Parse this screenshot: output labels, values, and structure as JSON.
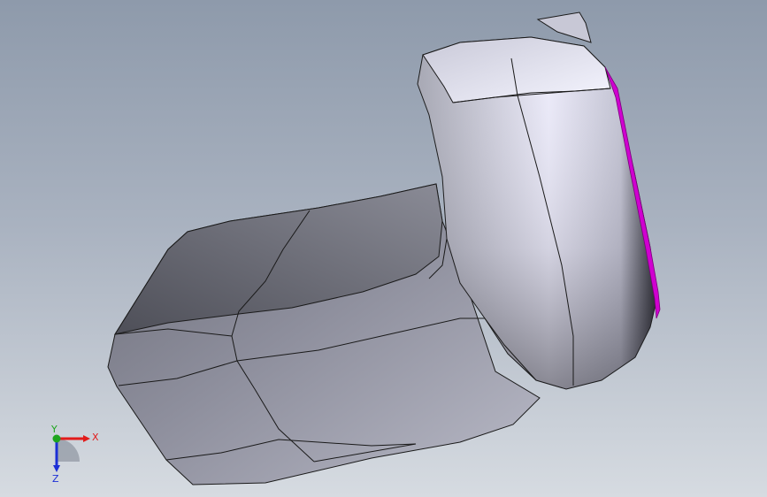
{
  "viewport": {
    "background_top": "#8e9aab",
    "background_bottom": "#d6dbe1",
    "model": {
      "body_color": "#9a9ba8",
      "highlight_color": "#e9e9f7",
      "edge_color": "#1a1a1a",
      "selected_face_color": "#d000d0"
    },
    "triad": {
      "x_label": "X",
      "y_label": "Y",
      "z_label": "Z",
      "x_color": "#e21b1b",
      "y_color": "#1ea51e",
      "z_color": "#1c2fd6"
    }
  }
}
